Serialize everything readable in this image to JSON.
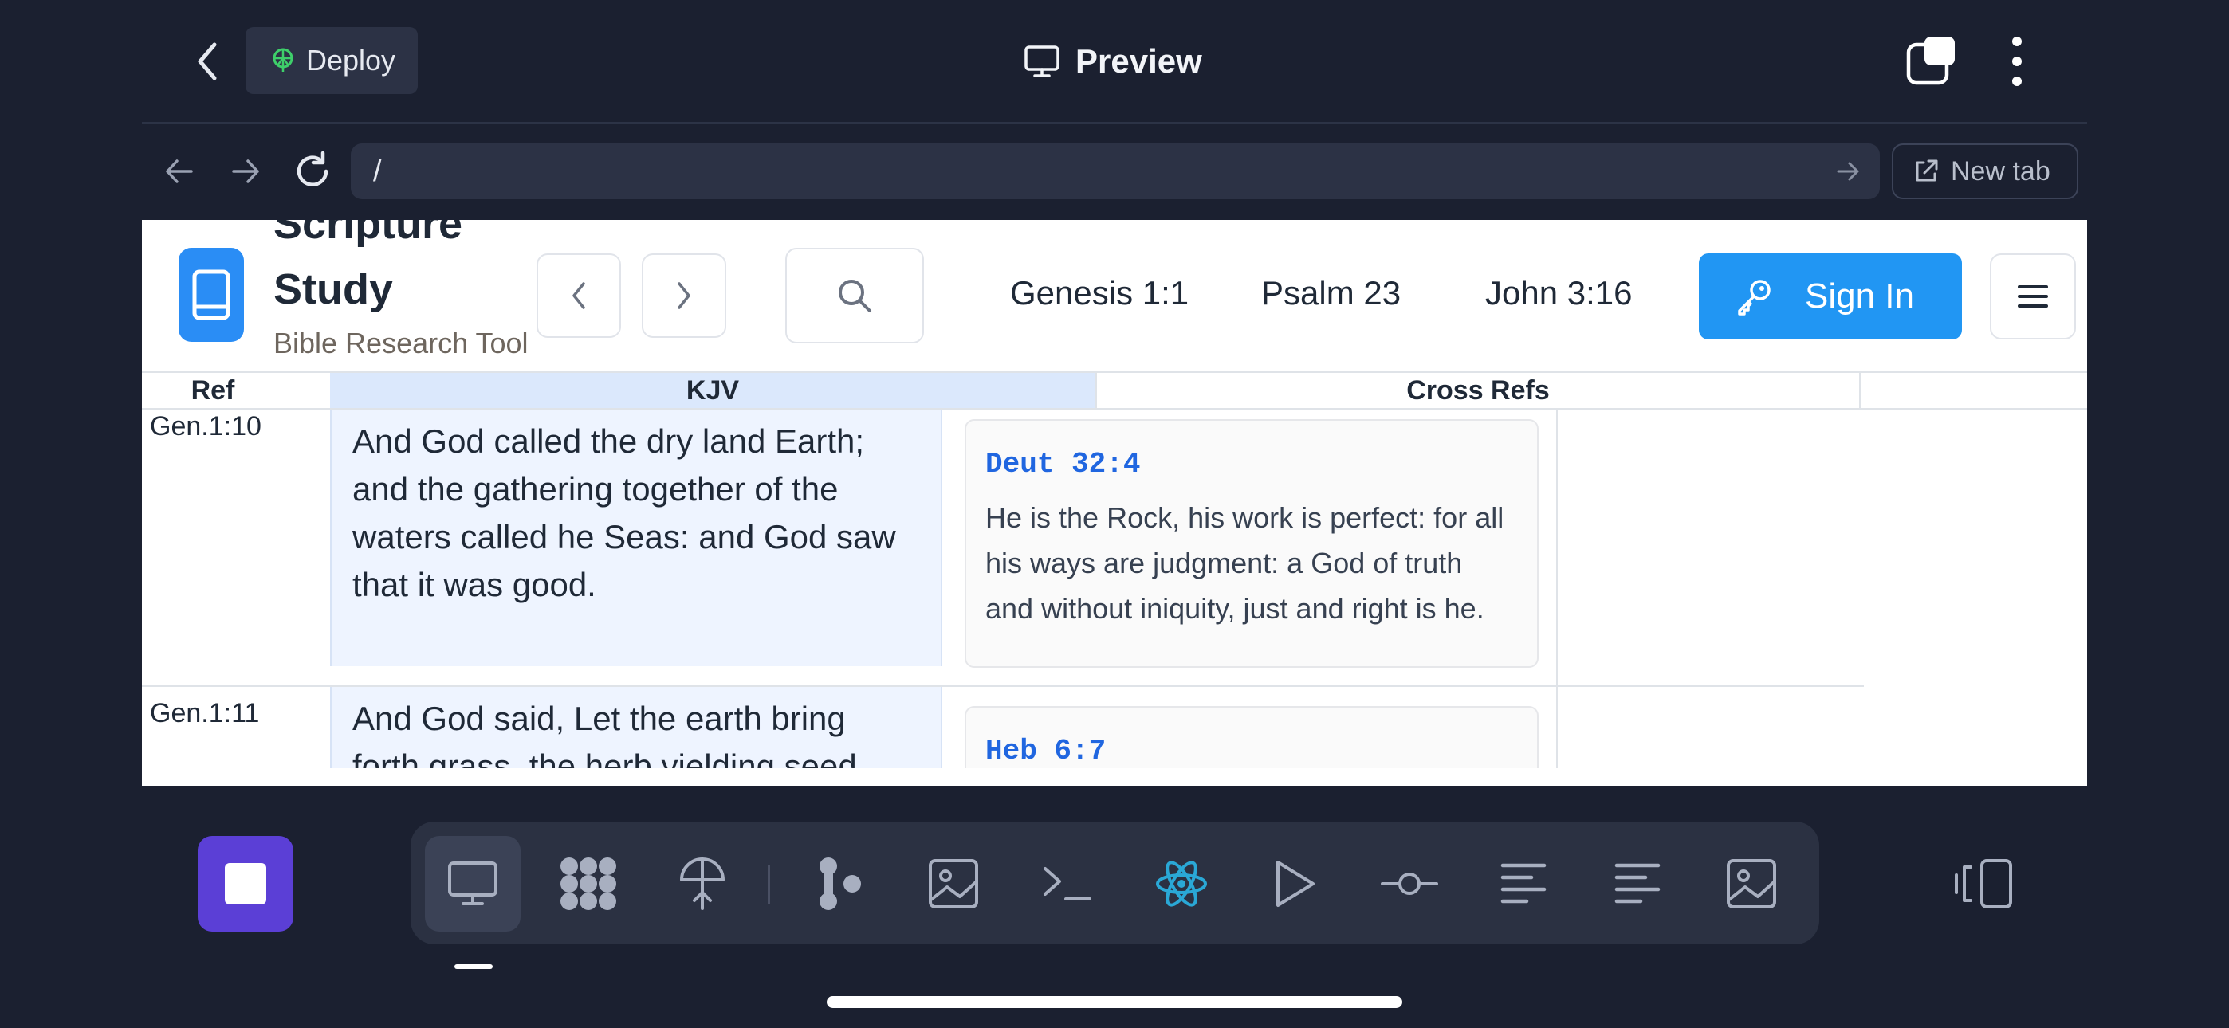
{
  "topbar": {
    "deploy_label": "Deploy",
    "title": "Preview"
  },
  "addressbar": {
    "url": "/",
    "new_tab_label": "New tab"
  },
  "site": {
    "title": "Scripture Study",
    "subtitle": "Bible Research Tool",
    "quick_links": [
      "Genesis 1:1",
      "Psalm 23",
      "John 3:16"
    ],
    "sign_in_label": "Sign In",
    "accent_color": "#2196f3"
  },
  "table": {
    "headers": {
      "ref": "Ref",
      "kjv": "KJV",
      "cross": "Cross Refs"
    },
    "rows": [
      {
        "ref": "Gen.1:10",
        "kjv": "And God called the dry land Earth; and the gathering together of the waters called he Seas: and God saw that it was good.",
        "xref": "Deut 32:4",
        "xref_text": "He is the Rock, his work is perfect: for all his ways are judgment: a God of truth and without iniquity, just and right is he."
      },
      {
        "ref": "Gen.1:11",
        "kjv": "And God said, Let the earth bring forth grass, the herb yielding seed,",
        "xref": "Heb 6:7",
        "xref_text": ""
      }
    ]
  },
  "dock": {
    "items": [
      "preview-icon",
      "apps-icon",
      "deploy-icon",
      "git-icon",
      "image-icon",
      "terminal-icon",
      "react-icon",
      "run-icon",
      "commit-icon",
      "logs-icon",
      "console-icon",
      "image-icon"
    ],
    "stop_color": "#5b3fd6"
  }
}
